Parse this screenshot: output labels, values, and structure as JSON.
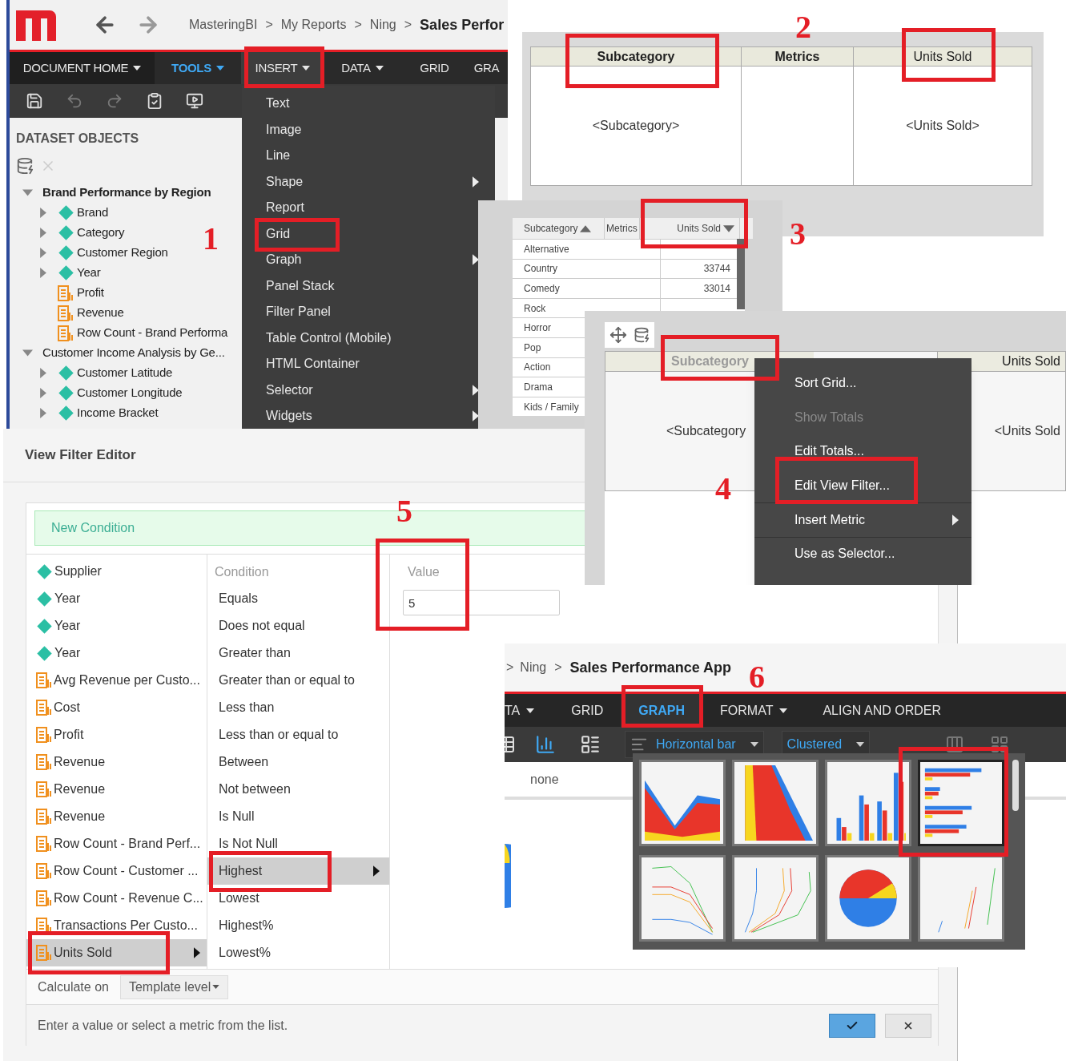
{
  "app": {
    "breadcrumb_separator": ">",
    "breadcrumb": [
      {
        "label": "MasteringBI",
        "current": false
      },
      {
        "label": "My Reports",
        "current": false
      },
      {
        "label": "Ning",
        "current": false
      },
      {
        "label": "Sales Perfor",
        "current": true
      }
    ],
    "menu_tabs": [
      {
        "label": "DOCUMENT HOME",
        "dropdown": true,
        "selected": false,
        "highlighted": false
      },
      {
        "label": "TOOLS",
        "dropdown": true,
        "selected": false,
        "highlighted": true
      },
      {
        "label": "INSERT",
        "dropdown": true,
        "selected": true,
        "highlighted": false
      },
      {
        "label": "DATA",
        "dropdown": true,
        "selected": false,
        "highlighted": false
      },
      {
        "label": "GRID",
        "dropdown": false,
        "selected": false,
        "highlighted": false
      },
      {
        "label": "GRA",
        "dropdown": false,
        "selected": false,
        "highlighted": false
      }
    ],
    "panel_title": "DATASET OBJECTS",
    "datasets": [
      {
        "label": "Brand Performance by Region",
        "current": true,
        "expanded": true,
        "children": [
          {
            "label": "Brand",
            "kind": "attribute"
          },
          {
            "label": "Category",
            "kind": "attribute"
          },
          {
            "label": "Customer Region",
            "kind": "attribute"
          },
          {
            "label": "Year",
            "kind": "attribute"
          },
          {
            "label": "Profit",
            "kind": "metric"
          },
          {
            "label": "Revenue",
            "kind": "metric"
          },
          {
            "label": "Row Count - Brand Performa",
            "kind": "metric"
          }
        ]
      },
      {
        "label": "Customer Income Analysis by Ge...",
        "current": false,
        "expanded": true,
        "children": [
          {
            "label": "Customer Latitude",
            "kind": "attribute"
          },
          {
            "label": "Customer Longitude",
            "kind": "attribute"
          },
          {
            "label": "Income Bracket",
            "kind": "attribute"
          }
        ]
      }
    ],
    "insert_menu": [
      {
        "label": "Text",
        "submenu": false
      },
      {
        "label": "Image",
        "submenu": false
      },
      {
        "label": "Line",
        "submenu": false
      },
      {
        "label": "Shape",
        "submenu": true
      },
      {
        "label": "Report",
        "submenu": false
      },
      {
        "label": "Grid",
        "submenu": false
      },
      {
        "label": "Graph",
        "submenu": true
      },
      {
        "label": "Panel Stack",
        "submenu": false
      },
      {
        "label": "Filter Panel",
        "submenu": false
      },
      {
        "label": "Table Control (Mobile)",
        "submenu": false
      },
      {
        "label": "HTML Container",
        "submenu": false
      },
      {
        "label": "Selector",
        "submenu": true
      },
      {
        "label": "Widgets",
        "submenu": true
      }
    ]
  },
  "template_grid": {
    "columns": [
      {
        "header": "Subcategory",
        "bold": true,
        "cell": "<Subcategory>"
      },
      {
        "header": "Metrics",
        "bold": true
      },
      {
        "header": "Units Sold",
        "bold": false,
        "cell": "<Units Sold>"
      }
    ]
  },
  "data_grid": {
    "columns": [
      {
        "label": "Subcategory",
        "sort_ascending": true,
        "sort_descending": false
      },
      {
        "label": "Metrics"
      },
      {
        "label": "Units Sold",
        "sort_ascending": false,
        "sort_descending": true
      }
    ],
    "rows": [
      {
        "name": "Alternative"
      },
      {
        "name": "Country",
        "value": "33744"
      },
      {
        "name": "Comedy",
        "value": "33014"
      },
      {
        "name": "Rock"
      },
      {
        "name": "Horror"
      },
      {
        "name": "Pop"
      },
      {
        "name": "Action"
      },
      {
        "name": "Drama"
      },
      {
        "name": "Kids / Family"
      }
    ]
  },
  "context_grid": {
    "columns": [
      {
        "header": "Subcategory",
        "cell": "<Subcategory"
      },
      {
        "header": "Units Sold",
        "cell": "<Units Sold"
      }
    ],
    "menu": [
      {
        "label": "Sort Grid...",
        "disabled": false,
        "submenu": false
      },
      {
        "label": "Show Totals",
        "disabled": true,
        "submenu": false
      },
      {
        "label": "Edit Totals...",
        "disabled": false,
        "submenu": false
      },
      {
        "label": "Edit View Filter...",
        "disabled": false,
        "submenu": false
      },
      {
        "label": "Insert Metric",
        "disabled": false,
        "submenu": true
      },
      {
        "label": "Use as Selector...",
        "disabled": false,
        "submenu": false
      }
    ]
  },
  "filter_editor": {
    "title": "View Filter Editor",
    "new_condition": "New Condition",
    "objects": [
      {
        "label": "Supplier",
        "kind": "attribute",
        "selected": false
      },
      {
        "label": "Year",
        "kind": "attribute",
        "selected": false
      },
      {
        "label": "Year",
        "kind": "attribute",
        "selected": false
      },
      {
        "label": "Year",
        "kind": "attribute",
        "selected": false
      },
      {
        "label": "Avg Revenue per Custo...",
        "kind": "metric",
        "selected": false
      },
      {
        "label": "Cost",
        "kind": "metric",
        "selected": false
      },
      {
        "label": "Profit",
        "kind": "metric",
        "selected": false
      },
      {
        "label": "Revenue",
        "kind": "metric",
        "selected": false
      },
      {
        "label": "Revenue",
        "kind": "metric",
        "selected": false
      },
      {
        "label": "Revenue",
        "kind": "metric",
        "selected": false
      },
      {
        "label": "Row Count - Brand Perf...",
        "kind": "metric",
        "selected": false
      },
      {
        "label": "Row Count - Customer ...",
        "kind": "metric",
        "selected": false
      },
      {
        "label": "Row Count - Revenue C...",
        "kind": "metric",
        "selected": false
      },
      {
        "label": "Transactions Per Custo...",
        "kind": "metric",
        "selected": false
      },
      {
        "label": "Units Sold",
        "kind": "metric",
        "selected": true
      }
    ],
    "condition_header": "Condition",
    "conditions": [
      {
        "label": "Equals",
        "selected": false
      },
      {
        "label": "Does not equal",
        "selected": false
      },
      {
        "label": "Greater than",
        "selected": false
      },
      {
        "label": "Greater than or equal to",
        "selected": false
      },
      {
        "label": "Less than",
        "selected": false
      },
      {
        "label": "Less than or equal to",
        "selected": false
      },
      {
        "label": "Between",
        "selected": false
      },
      {
        "label": "Not between",
        "selected": false
      },
      {
        "label": "Is Null",
        "selected": false
      },
      {
        "label": "Is Not Null",
        "selected": false
      },
      {
        "label": "Highest",
        "selected": true
      },
      {
        "label": "Lowest",
        "selected": false
      },
      {
        "label": "Highest%",
        "selected": false
      },
      {
        "label": "Lowest%",
        "selected": false
      }
    ],
    "value_header": "Value",
    "value": "5",
    "calculate_label": "Calculate on",
    "calculate_value": "Template level",
    "hint": "Enter a value or select a metric from the list."
  },
  "graph_app": {
    "breadcrumb_separator": ">",
    "breadcrumb": [
      {
        "label": "Ning",
        "current": false
      },
      {
        "label": "Sales Performance App",
        "current": true
      }
    ],
    "tabs": [
      {
        "label": "TA",
        "dropdown": true,
        "selected": false
      },
      {
        "label": "GRID",
        "dropdown": false,
        "selected": false
      },
      {
        "label": "GRAPH",
        "dropdown": false,
        "selected": true
      },
      {
        "label": "FORMAT",
        "dropdown": true,
        "selected": false
      },
      {
        "label": "ALIGN AND ORDER",
        "dropdown": false,
        "selected": false
      }
    ],
    "graph_type": "Horizontal bar",
    "graph_style": "Clustered",
    "setting_value": "none",
    "gallery": [
      {
        "kind": "area",
        "selected": false
      },
      {
        "kind": "vertical-area",
        "selected": false
      },
      {
        "kind": "vertical-bar",
        "selected": false
      },
      {
        "kind": "horizontal-bar",
        "selected": true
      },
      {
        "kind": "line",
        "selected": false
      },
      {
        "kind": "vertical-line",
        "selected": false
      },
      {
        "kind": "pie",
        "selected": false
      },
      {
        "kind": "scatter",
        "selected": false
      }
    ]
  },
  "annotations": [
    {
      "label": "1"
    },
    {
      "label": "2"
    },
    {
      "label": "3"
    },
    {
      "label": "4"
    },
    {
      "label": "5"
    },
    {
      "label": "6"
    }
  ]
}
